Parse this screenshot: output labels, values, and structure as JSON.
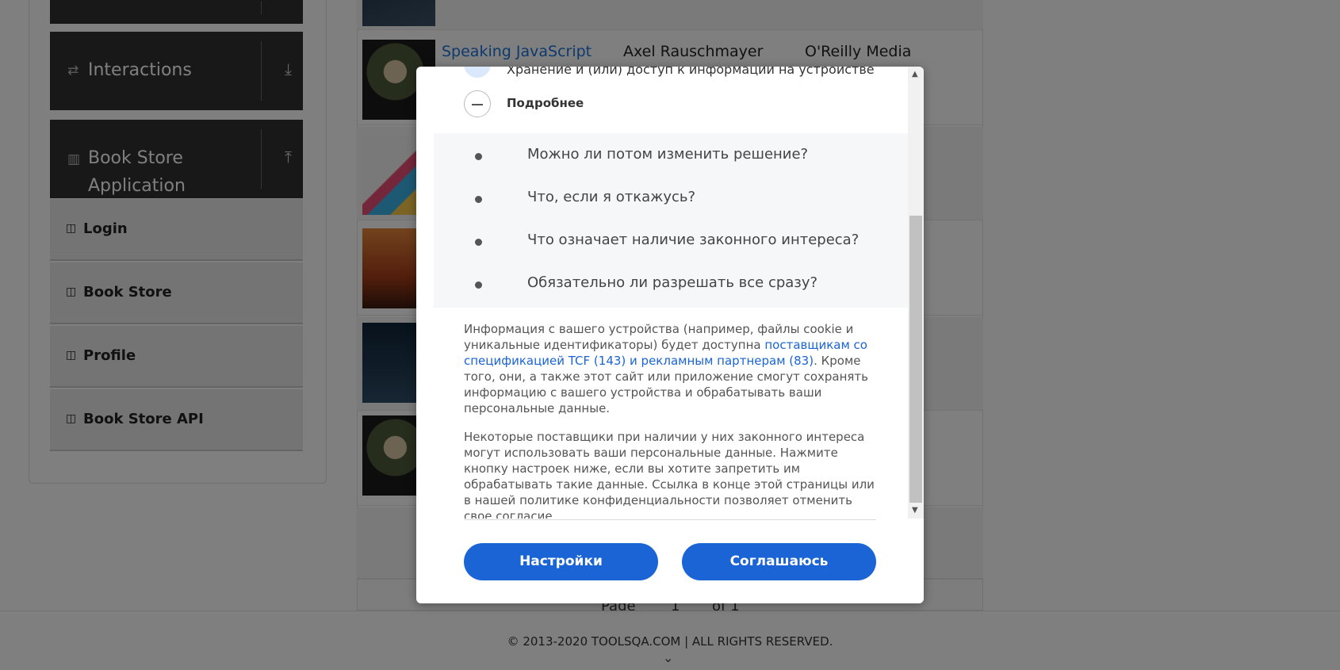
{
  "sidebar": {
    "groups": [
      {
        "label": "Interactions",
        "icon": "interactions-icon",
        "arrow": "download-icon"
      },
      {
        "label_line1": "Book Store",
        "label_line2": "Application",
        "icon": "books-icon",
        "arrow": "upload-icon"
      }
    ],
    "items": [
      {
        "label": "Login"
      },
      {
        "label": "Book Store"
      },
      {
        "label": "Profile"
      },
      {
        "label": "Book Store API"
      }
    ]
  },
  "table": {
    "first_row": {
      "title": "Speaking JavaScript",
      "author": "Axel Rauschmayer",
      "publisher": "O'Reilly Media"
    }
  },
  "pager": {
    "page_label": "Page",
    "page_number": "1",
    "of_label": "of 1"
  },
  "footer": {
    "text": "© 2013-2020 TOOLSQA.COM | ALL RIGHTS RESERVED."
  },
  "modal": {
    "partial_line": "Хранение и (или) доступ к информации на устройстве",
    "expand_label": "Подробнее",
    "faq": [
      "Можно ли потом изменить решение?",
      "Что, если я откажусь?",
      "Что означает наличие законного интереса?",
      "Обязательно ли разрешать все сразу?"
    ],
    "para1_before": "Информация с вашего устройства (например, файлы cookie и уникальные идентификаторы) будет доступна ",
    "para1_link": "поставщикам со спецификацией TCF (143) и рекламным партнерам (83)",
    "para1_after": ". Кроме того, они, а также этот сайт или приложение смогут сохранять информацию с вашего устройства и обрабатывать ваши персональные данные.",
    "para2": "Некоторые поставщики при наличии у них законного интереса могут использовать ваши персональные данные. Нажмите кнопку настроек ниже, если вы хотите запретить им обрабатывать такие данные. Ссылка в конце этой страницы или в нашей политике конфиденциальности позволяет отменить свое согласие.",
    "buttons": {
      "settings": "Настройки",
      "agree": "Соглашаюсь"
    }
  },
  "colors": {
    "accent": "#1a64d6",
    "sidebar_dark": "#313131",
    "overlay": "rgba(0,0,0,0.5)"
  }
}
